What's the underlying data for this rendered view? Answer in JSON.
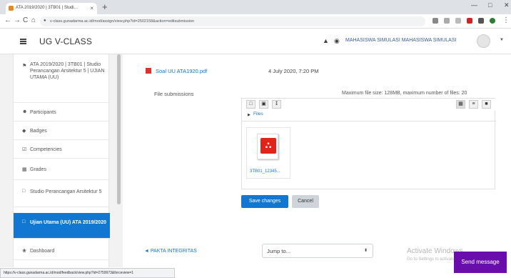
{
  "browser": {
    "tab_title": "ATA 2019/2020 | 3TB01 | Studi…",
    "tab_close": "×",
    "new_tab": "+",
    "win_min": "—",
    "win_max": "□",
    "win_close": "✕",
    "back": "←",
    "forward": "→",
    "reload": "C",
    "home": "⌂",
    "url": "v-class.gunadarma.ac.id/mod/assign/view.php?id=2502158&action=editsubmission",
    "status_url": "https://v-class.gunadarma.ac.id/mod/feedback/view.php?id=2759973&forceview=1"
  },
  "navbar": {
    "site_name": "UG V-CLASS",
    "user_name": "MAHASISWA SIMULASI MAHASISWA SIMULASI"
  },
  "sidebar": {
    "items": [
      {
        "icon": "graduation-cap-icon",
        "glyph": "⚑",
        "label": "ATA 2019/2020 | 3TB01 | Studio Perancangan Arsitektur 5 | UJIAN UTAMA (UU)"
      },
      {
        "icon": "users-icon",
        "glyph": "☻",
        "label": "Participants"
      },
      {
        "icon": "shield-icon",
        "glyph": "◆",
        "label": "Badges"
      },
      {
        "icon": "checkbox-icon",
        "glyph": "☑",
        "label": "Competencies"
      },
      {
        "icon": "table-icon",
        "glyph": "▦",
        "label": "Grades"
      },
      {
        "icon": "folder-icon",
        "glyph": "□",
        "label": "Studio Perancangan Arsitektur 5"
      },
      {
        "icon": "folder-icon",
        "glyph": "□",
        "label": "Ujian Utama (UU) ATA 2019/2020"
      },
      {
        "icon": "dashboard-icon",
        "glyph": "❀",
        "label": "Dashboard"
      }
    ]
  },
  "main": {
    "file_name": "Soal UU ATA1920.pdf",
    "file_date": "4 July 2020, 7:20 PM",
    "submission_label": "File submissions",
    "max_size_text": "Maximum file size: 128MB, maximum number of files: 20",
    "fm_path": "Files",
    "uploaded_file": "3TB01_12345...",
    "pdf_glyph": "∴",
    "save_button": "Save changes",
    "cancel_button": "Cancel",
    "prev_link": "◄ PAKTA INTEGRITAS",
    "jump_to": "Jump to...",
    "jump_arrow": "⬍"
  },
  "overlay": {
    "activate_title": "Activate Windows",
    "activate_sub": "Go to Settings to activate Windows.",
    "send_message": "Send message"
  },
  "colors": {
    "accent": "#1177d1",
    "send_bg": "#6a0dad",
    "pdf_red": "#e2231a"
  }
}
